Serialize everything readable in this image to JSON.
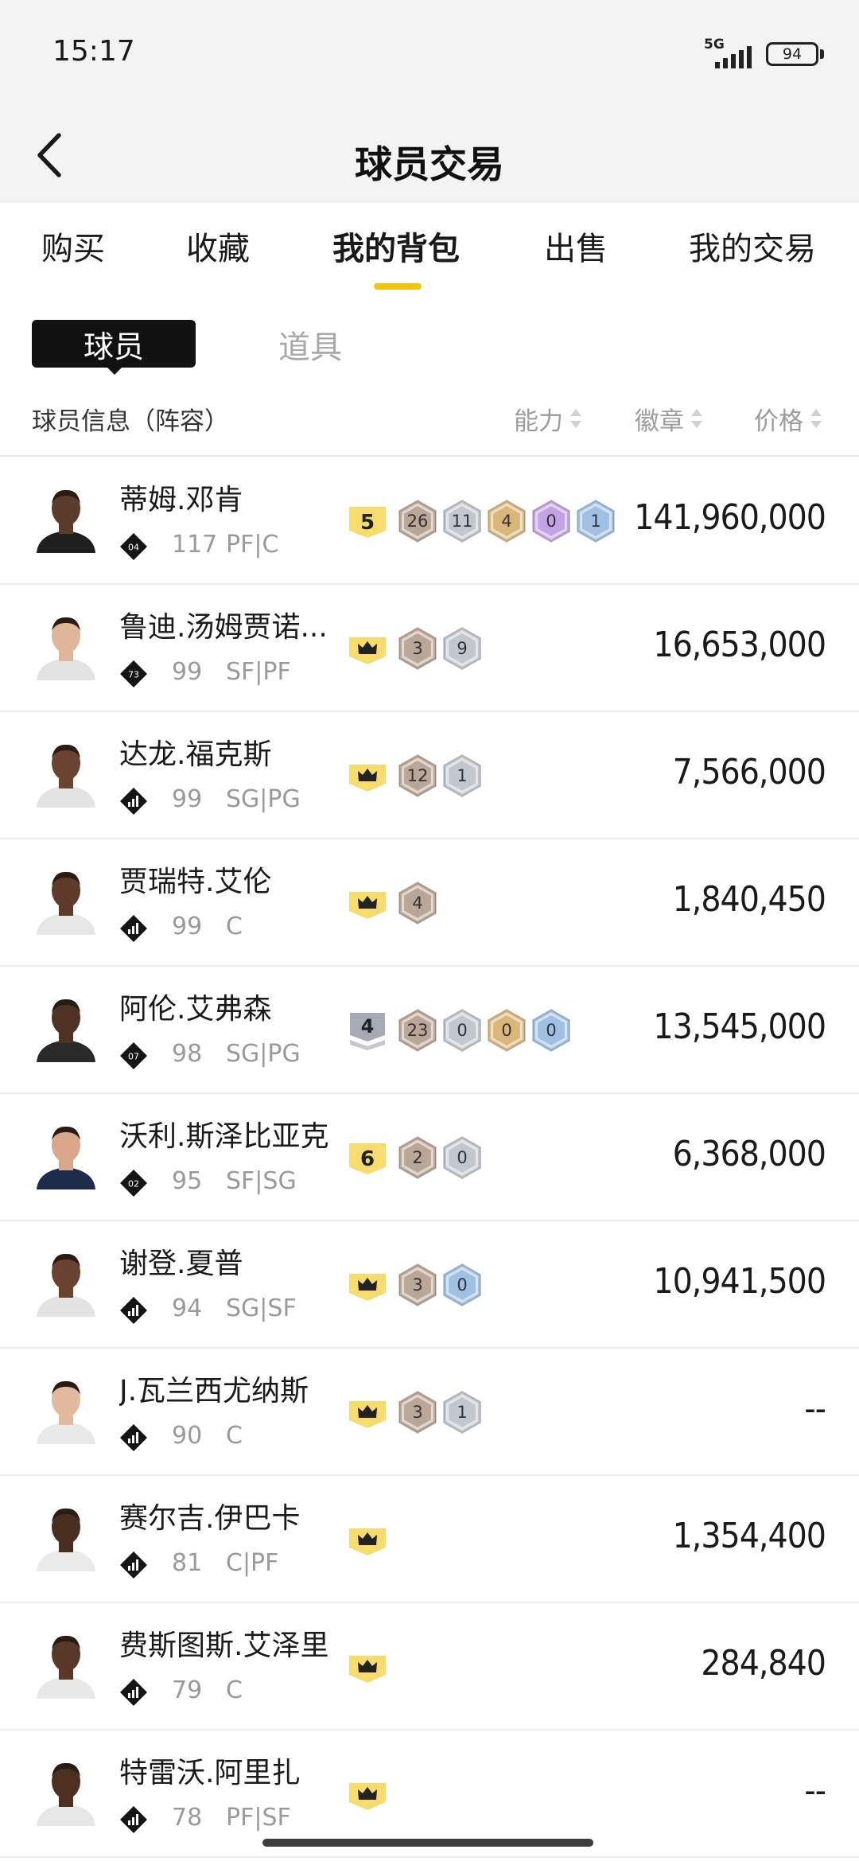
{
  "status_bar": {
    "time": "15:17",
    "network": "5G",
    "battery": "94"
  },
  "nav": {
    "title": "球员交易"
  },
  "tabs": [
    {
      "label": "购买",
      "active": false
    },
    {
      "label": "收藏",
      "active": false
    },
    {
      "label": "我的背包",
      "active": true
    },
    {
      "label": "出售",
      "active": false
    },
    {
      "label": "我的交易",
      "active": false
    }
  ],
  "subtabs": [
    {
      "label": "球员",
      "active": true
    },
    {
      "label": "道具",
      "active": false
    }
  ],
  "table_header": {
    "info": "球员信息（阵容）",
    "ability": "能力",
    "badges": "徽章",
    "price": "价格"
  },
  "colors": {
    "accent": "#f1c40f",
    "tier_badge": "#f6dc6c",
    "bronze": "#b9a697",
    "silver": "#c2c6cf",
    "gold": "#d9b77a",
    "purple": "#c3a2e6",
    "blue": "#9ec0e2"
  },
  "players": [
    {
      "name": "蒂姆.邓肯",
      "tier": "04",
      "rating": "117",
      "position": "PF|C",
      "level": "5",
      "level_type": "number",
      "badges": [
        {
          "value": "26",
          "type": "bronze"
        },
        {
          "value": "11",
          "type": "silver"
        },
        {
          "value": "4",
          "type": "gold"
        },
        {
          "value": "0",
          "type": "purple"
        },
        {
          "value": "1",
          "type": "blue"
        }
      ],
      "price": "141,960,000",
      "skin": "#5b3b2a",
      "jersey": "#1f1f1f"
    },
    {
      "name": "鲁迪.汤姆贾诺...",
      "tier": "73",
      "rating": "99",
      "position": "SF|PF",
      "level": "",
      "level_type": "crown",
      "badges": [
        {
          "value": "3",
          "type": "bronze"
        },
        {
          "value": "9",
          "type": "silver"
        }
      ],
      "price": "16,653,000",
      "skin": "#e0b69a",
      "jersey": "#e3e3e3"
    },
    {
      "name": "达龙.福克斯",
      "tier": "",
      "rating": "99",
      "position": "SG|PG",
      "level": "",
      "level_type": "crown",
      "badges": [
        {
          "value": "12",
          "type": "bronze"
        },
        {
          "value": "1",
          "type": "silver"
        }
      ],
      "price": "7,566,000",
      "skin": "#6b4431",
      "jersey": "#e3e3e3"
    },
    {
      "name": "贾瑞特.艾伦",
      "tier": "",
      "rating": "99",
      "position": "C",
      "level": "",
      "level_type": "crown",
      "badges": [
        {
          "value": "4",
          "type": "bronze"
        }
      ],
      "price": "1,840,450",
      "skin": "#5e3a29",
      "jersey": "#e6e6e6"
    },
    {
      "name": "阿伦.艾弗森",
      "tier": "07",
      "rating": "98",
      "position": "SG|PG",
      "level": "4",
      "level_type": "chevron",
      "badges": [
        {
          "value": "23",
          "type": "bronze"
        },
        {
          "value": "0",
          "type": "silver"
        },
        {
          "value": "0",
          "type": "gold"
        },
        {
          "value": "0",
          "type": "blue"
        }
      ],
      "price": "13,545,000",
      "skin": "#4f3223",
      "jersey": "#2a2a2a"
    },
    {
      "name": "沃利.斯泽比亚克",
      "tier": "02",
      "rating": "95",
      "position": "SF|SG",
      "level": "6",
      "level_type": "number",
      "badges": [
        {
          "value": "2",
          "type": "bronze"
        },
        {
          "value": "0",
          "type": "silver"
        }
      ],
      "price": "6,368,000",
      "skin": "#d9a88a",
      "jersey": "#1f2b4a"
    },
    {
      "name": "谢登.夏普",
      "tier": "",
      "rating": "94",
      "position": "SG|SF",
      "level": "",
      "level_type": "crown",
      "badges": [
        {
          "value": "3",
          "type": "bronze"
        },
        {
          "value": "0",
          "type": "blue"
        }
      ],
      "price": "10,941,500",
      "skin": "#6a4330",
      "jersey": "#e3e3e3"
    },
    {
      "name": "J.瓦兰西尤纳斯",
      "tier": "",
      "rating": "90",
      "position": "C",
      "level": "",
      "level_type": "crown",
      "badges": [
        {
          "value": "3",
          "type": "bronze"
        },
        {
          "value": "1",
          "type": "silver"
        }
      ],
      "price": "--",
      "skin": "#e2b99d",
      "jersey": "#e9e9e9"
    },
    {
      "name": "赛尔吉.伊巴卡",
      "tier": "",
      "rating": "81",
      "position": "C|PF",
      "level": "",
      "level_type": "crown",
      "badges": [],
      "price": "1,354,400",
      "skin": "#4a2e20",
      "jersey": "#eaeaea"
    },
    {
      "name": "费斯图斯.艾泽里",
      "tier": "",
      "rating": "79",
      "position": "C",
      "level": "",
      "level_type": "crown",
      "badges": [],
      "price": "284,840",
      "skin": "#5a3828",
      "jersey": "#e8e8e8"
    },
    {
      "name": "特雷沃.阿里扎",
      "tier": "",
      "rating": "78",
      "position": "PF|SF",
      "level": "",
      "level_type": "crown",
      "badges": [],
      "price": "--",
      "skin": "#4d3022",
      "jersey": "#e6e6e6"
    }
  ]
}
